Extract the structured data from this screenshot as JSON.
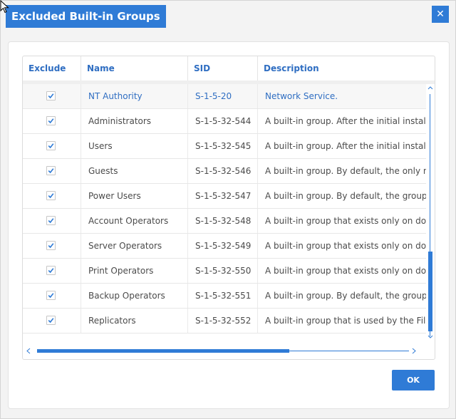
{
  "dialog": {
    "title": "Excluded Built-in Groups",
    "close_glyph": "✕",
    "ok_label": "OK"
  },
  "grid": {
    "columns": [
      "Exclude",
      "Name",
      "SID",
      "Description"
    ],
    "rows": [
      {
        "exclude": true,
        "name": "NT Authority",
        "sid": "S-1-5-20",
        "description": "Network Service."
      },
      {
        "exclude": true,
        "name": "Administrators",
        "sid": "S-1-5-32-544",
        "description": "A built-in group. After the initial install"
      },
      {
        "exclude": true,
        "name": "Users",
        "sid": "S-1-5-32-545",
        "description": "A built-in group. After the initial install"
      },
      {
        "exclude": true,
        "name": "Guests",
        "sid": "S-1-5-32-546",
        "description": "A built-in group. By default, the only n"
      },
      {
        "exclude": true,
        "name": "Power Users",
        "sid": "S-1-5-32-547",
        "description": "A built-in group. By default, the group"
      },
      {
        "exclude": true,
        "name": "Account Operators",
        "sid": "S-1-5-32-548",
        "description": "A built-in group that exists only on do"
      },
      {
        "exclude": true,
        "name": "Server Operators",
        "sid": "S-1-5-32-549",
        "description": "A built-in group that exists only on do"
      },
      {
        "exclude": true,
        "name": "Print Operators",
        "sid": "S-1-5-32-550",
        "description": "A built-in group that exists only on do"
      },
      {
        "exclude": true,
        "name": "Backup Operators",
        "sid": "S-1-5-32-551",
        "description": "A built-in group. By default, the group"
      },
      {
        "exclude": true,
        "name": "Replicators",
        "sid": "S-1-5-32-552",
        "description": "A built-in group that is used by the Fil"
      }
    ]
  },
  "icons": [
    "cursor-icon",
    "close-icon",
    "checkmark-icon",
    "scroll-up-icon",
    "scroll-down-icon",
    "scroll-left-icon",
    "scroll-right-icon"
  ],
  "colors": {
    "accent": "#2f7bd6",
    "header_text": "#2f6ec2",
    "body_text": "#4b4b4b"
  }
}
